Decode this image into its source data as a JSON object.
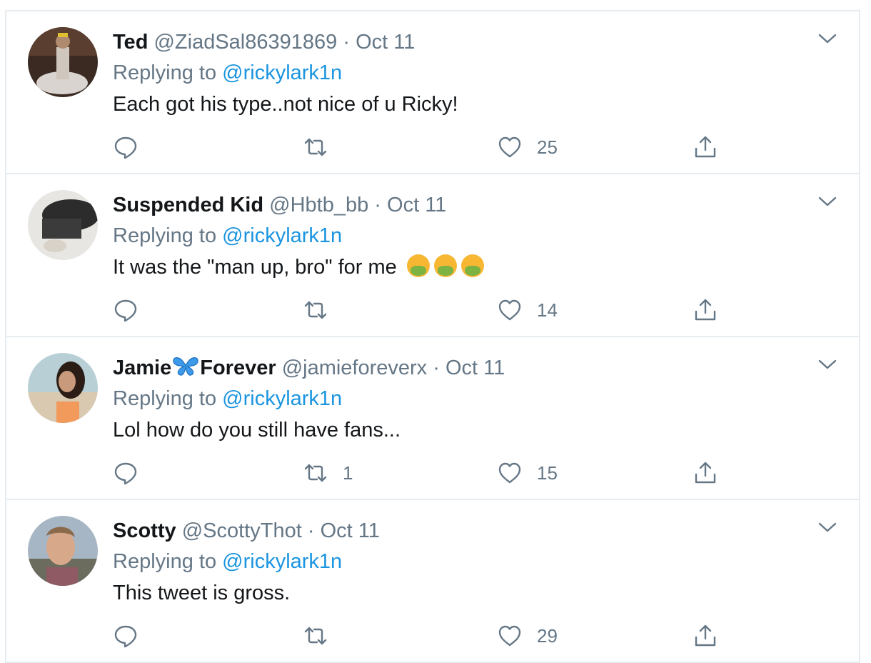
{
  "colors": {
    "link": "#1b95e0",
    "muted": "#657786",
    "text": "#14171a",
    "border": "#e6ecf0"
  },
  "tweets": [
    {
      "name": "Ted",
      "handle": "@ZiadSal86391869",
      "dot": "·",
      "date": "Oct 11",
      "replying_prefix": "Replying to",
      "replying_to": "@rickylark1n",
      "text": "Each got his type..not nice of u Ricky!",
      "reply_count": "",
      "retweet_count": "",
      "like_count": "25"
    },
    {
      "name": "Suspended Kid",
      "handle": "@Hbtb_bb",
      "dot": "·",
      "date": "Oct 11",
      "replying_prefix": "Replying to",
      "replying_to": "@rickylark1n",
      "text": "It was the \"man up, bro\" for me",
      "emojis": [
        "nauseated-face-emoji",
        "nauseated-face-emoji",
        "nauseated-face-emoji"
      ],
      "reply_count": "",
      "retweet_count": "",
      "like_count": "14"
    },
    {
      "name_part1": "Jamie",
      "name_part2": "Forever",
      "name_icon": "butterfly-icon",
      "handle": "@jamieforeverx",
      "dot": "·",
      "date": "Oct 11",
      "replying_prefix": "Replying to",
      "replying_to": "@rickylark1n",
      "text": "Lol how do you still have fans...",
      "reply_count": "",
      "retweet_count": "1",
      "like_count": "15"
    },
    {
      "name": "Scotty",
      "handle": "@ScottyThot",
      "dot": "·",
      "date": "Oct 11",
      "replying_prefix": "Replying to",
      "replying_to": "@rickylark1n",
      "text": "This tweet is gross.",
      "reply_count": "",
      "retweet_count": "",
      "like_count": "29"
    }
  ],
  "icons": {
    "reply": "reply-icon",
    "retweet": "retweet-icon",
    "like": "heart-icon",
    "share": "share-icon",
    "more": "chevron-down-icon"
  }
}
